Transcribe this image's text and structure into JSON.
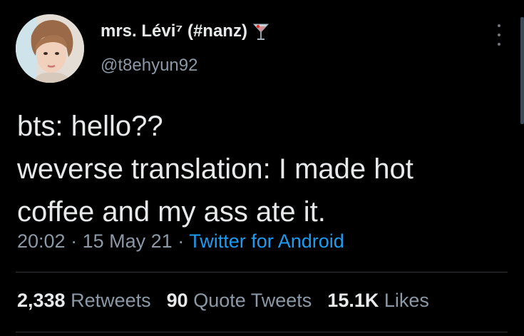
{
  "author": {
    "display_name": "mrs. Lévi⁷ (#nanz)",
    "handle": "@t8ehyun92",
    "name_emoji_icon": "cocktail-glass-icon",
    "avatar": "profile-photo"
  },
  "tweet": {
    "lines": [
      "bts: hello??",
      "weverse translation: I made hot",
      "coffee and my ass ate it."
    ],
    "time": "20:02",
    "date": "15 May 21",
    "separator": "·",
    "source": "Twitter for Android"
  },
  "stats": {
    "retweets_count": "2,338",
    "retweets_label": "Retweets",
    "quote_count": "90",
    "quote_label": "Quote Tweets",
    "likes_count": "15.1K",
    "likes_label": "Likes"
  },
  "colors": {
    "background": "#000000",
    "text": "#e7e9ea",
    "muted": "#8b98a5",
    "link": "#1d9bf0"
  }
}
